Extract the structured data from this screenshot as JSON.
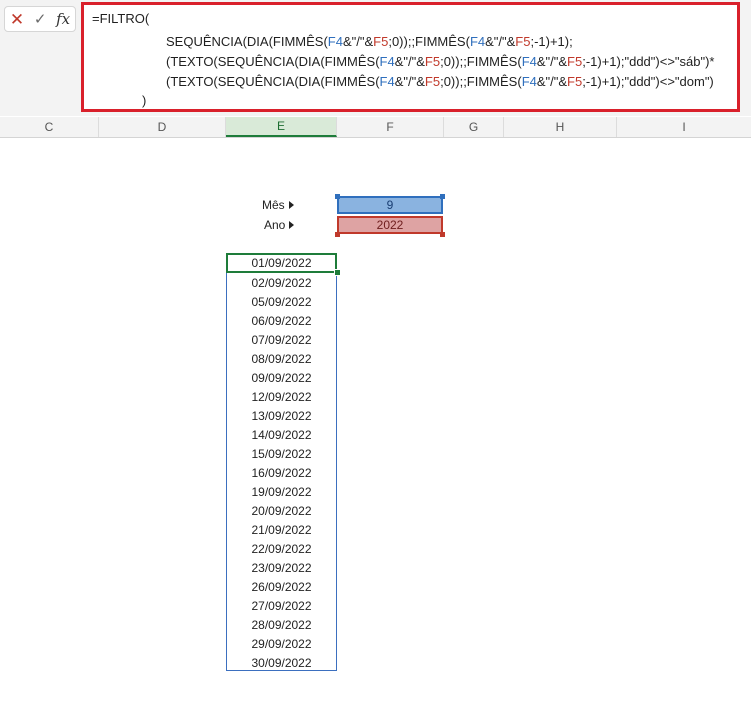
{
  "formula_toolbar": {
    "cancel_icon": "close-icon",
    "enter_icon": "check-icon",
    "fx_label": "fx"
  },
  "formula": {
    "line1": "=FILTRO(",
    "line2": {
      "a": "SEQUÊNCIA(DIA(FIMMÊS(",
      "ref1": "F4",
      "b": "&\"/\"&",
      "ref2": "F5",
      "c": ";0));;FIMMÊS(",
      "ref3": "F4",
      "d": "&\"/\"&",
      "ref4": "F5",
      "e": ";-1)+1);"
    },
    "line3": {
      "a": "(TEXTO(SEQUÊNCIA(DIA(FIMMÊS(",
      "ref1": "F4",
      "b": "&\"/\"&",
      "ref2": "F5",
      "c": ";0));;FIMMÊS(",
      "ref3": "F4",
      "d": "&\"/\"&",
      "ref4": "F5",
      "e": ";-1)+1);\"ddd\")<>\"sáb\")*"
    },
    "line4": {
      "a": "(TEXTO(SEQUÊNCIA(DIA(FIMMÊS(",
      "ref1": "F4",
      "b": "&\"/\"&",
      "ref2": "F5",
      "c": ";0));;FIMMÊS(",
      "ref3": "F4",
      "d": "&\"/\"&",
      "ref4": "F5",
      "e": ";-1)+1);\"ddd\")<>\"dom\")"
    },
    "line5": ")"
  },
  "columns": [
    "C",
    "D",
    "E",
    "F",
    "G",
    "H",
    "I"
  ],
  "labels": {
    "mes": "Mês",
    "ano": "Ano"
  },
  "inputs": {
    "mes": "9",
    "ano": "2022"
  },
  "dates": [
    "01/09/2022",
    "02/09/2022",
    "05/09/2022",
    "06/09/2022",
    "07/09/2022",
    "08/09/2022",
    "09/09/2022",
    "12/09/2022",
    "13/09/2022",
    "14/09/2022",
    "15/09/2022",
    "16/09/2022",
    "19/09/2022",
    "20/09/2022",
    "21/09/2022",
    "22/09/2022",
    "23/09/2022",
    "26/09/2022",
    "27/09/2022",
    "28/09/2022",
    "29/09/2022",
    "30/09/2022"
  ],
  "colors": {
    "accent_green": "#1e7c3a",
    "ref_blue": "#2f6fbd",
    "ref_red": "#c0392b",
    "highlight_border": "#d9202b"
  }
}
